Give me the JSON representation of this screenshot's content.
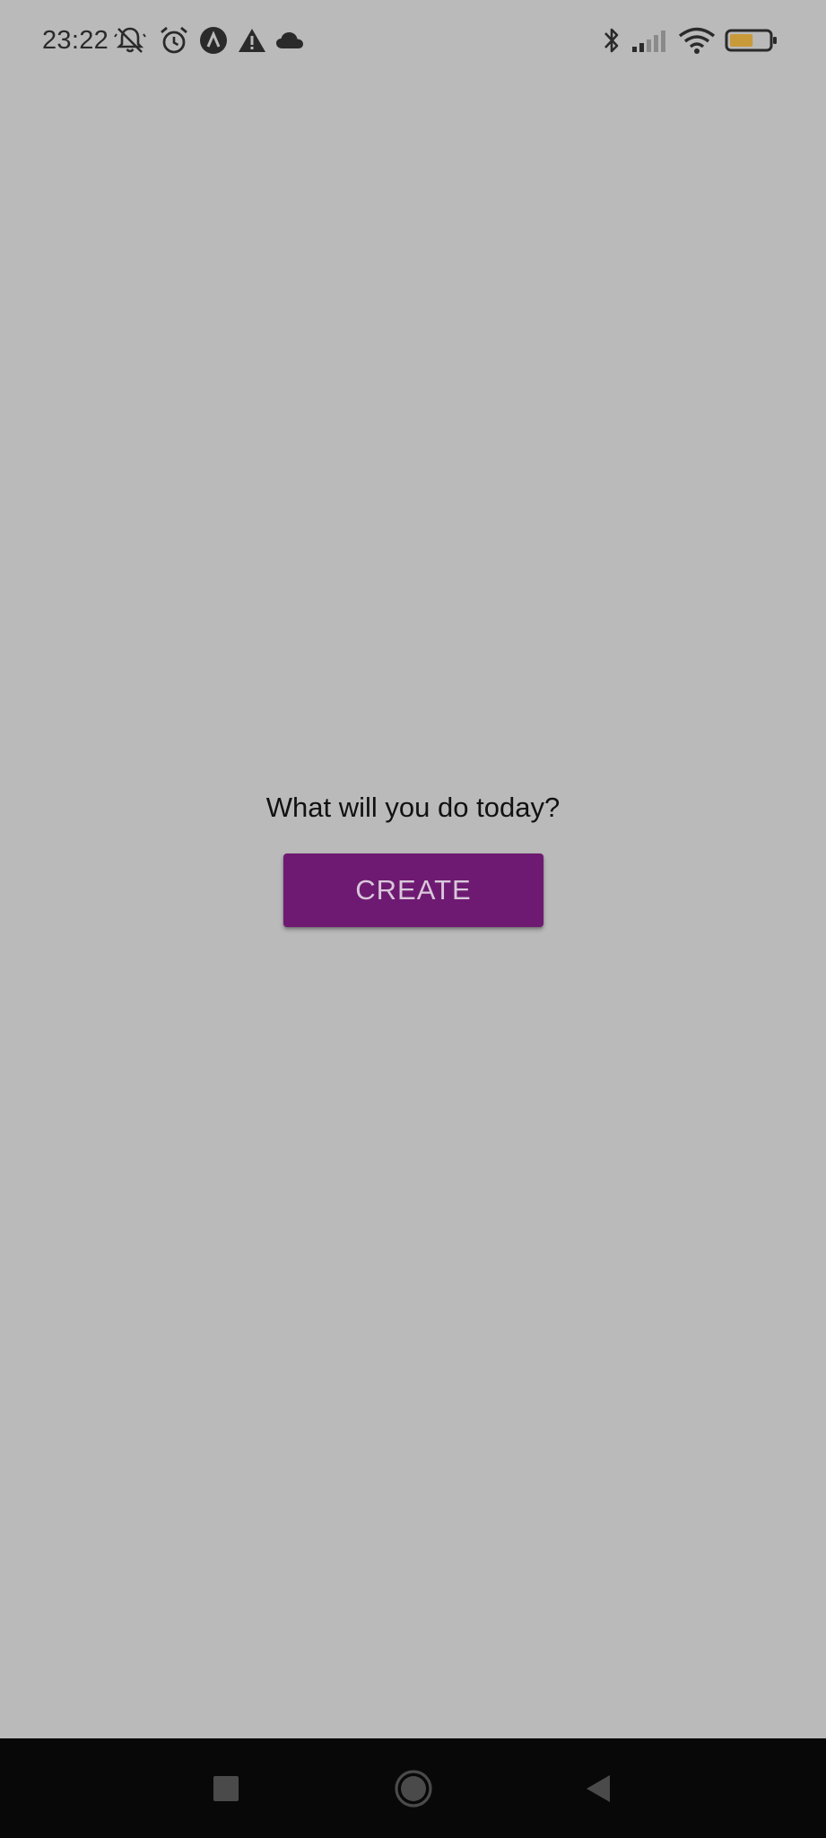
{
  "status_bar": {
    "time": "23:22",
    "left_icons": [
      "notifications-muted-icon",
      "alarm-icon",
      "app-notification-icon",
      "warning-icon",
      "cloud-icon"
    ],
    "right_icons": [
      "bluetooth-icon",
      "cellular-signal-icon",
      "wifi-icon",
      "battery-icon"
    ],
    "battery_level_percent": 60,
    "battery_color": "#c99a3a"
  },
  "main": {
    "prompt": "What will you do today?",
    "create_label": "CREATE"
  },
  "nav_bar": {
    "buttons": [
      "recents-button",
      "home-button",
      "back-button"
    ]
  },
  "colors": {
    "background": "#bababa",
    "button": "#6e1a72",
    "button_text": "#d9c8da",
    "nav_bar": "#080808"
  }
}
